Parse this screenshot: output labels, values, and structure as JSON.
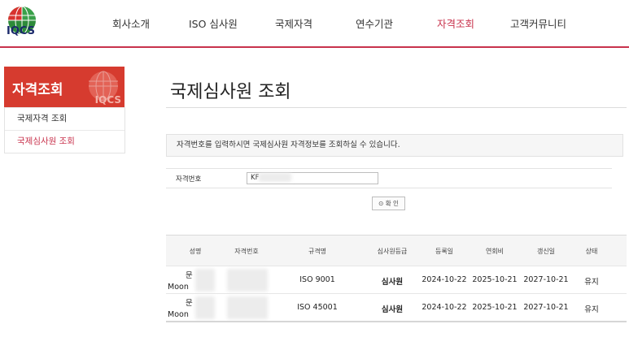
{
  "header": {
    "logo_text": "IQCS",
    "nav": [
      {
        "label": "회사소개"
      },
      {
        "label": "ISO 심사원"
      },
      {
        "label": "국제자격"
      },
      {
        "label": "연수기관"
      },
      {
        "label": "자격조회",
        "active": true
      },
      {
        "label": "고객커뮤니티"
      }
    ]
  },
  "sidebar": {
    "title": "자격조회",
    "logo_text": "IQCS",
    "items": [
      {
        "label": "국제자격 조회"
      },
      {
        "label": "국제심사원 조회",
        "active": true
      }
    ]
  },
  "main": {
    "title": "국제심사원 조회",
    "notice": "자격번호를 입력하시면 국제심사원 자격정보를 조회하실 수 있습니다.",
    "form": {
      "label": "자격번호",
      "value": "KF"
    },
    "confirm_label": "⊙ 확  인"
  },
  "table": {
    "headers": [
      "성명",
      "자격번호",
      "규격명",
      "심사원등급",
      "등록일",
      "연회비",
      "갱신일",
      "상태"
    ],
    "rows": [
      {
        "name_ko": "문",
        "name_en": "Moon",
        "cert_no": "",
        "standard": "ISO 9001",
        "grade": "심사원",
        "registered": "2024-10-22",
        "annual_fee": "2025-10-21",
        "renewal": "2027-10-21",
        "status": "유지"
      },
      {
        "name_ko": "문",
        "name_en": "Moon",
        "cert_no": "",
        "standard": "ISO 45001",
        "grade": "심사원",
        "registered": "2024-10-22",
        "annual_fee": "2025-10-21",
        "renewal": "2027-10-21",
        "status": "유지"
      }
    ]
  },
  "colors": {
    "accent": "#c8324c",
    "sidebar_title_bg": "#d63b2f"
  }
}
